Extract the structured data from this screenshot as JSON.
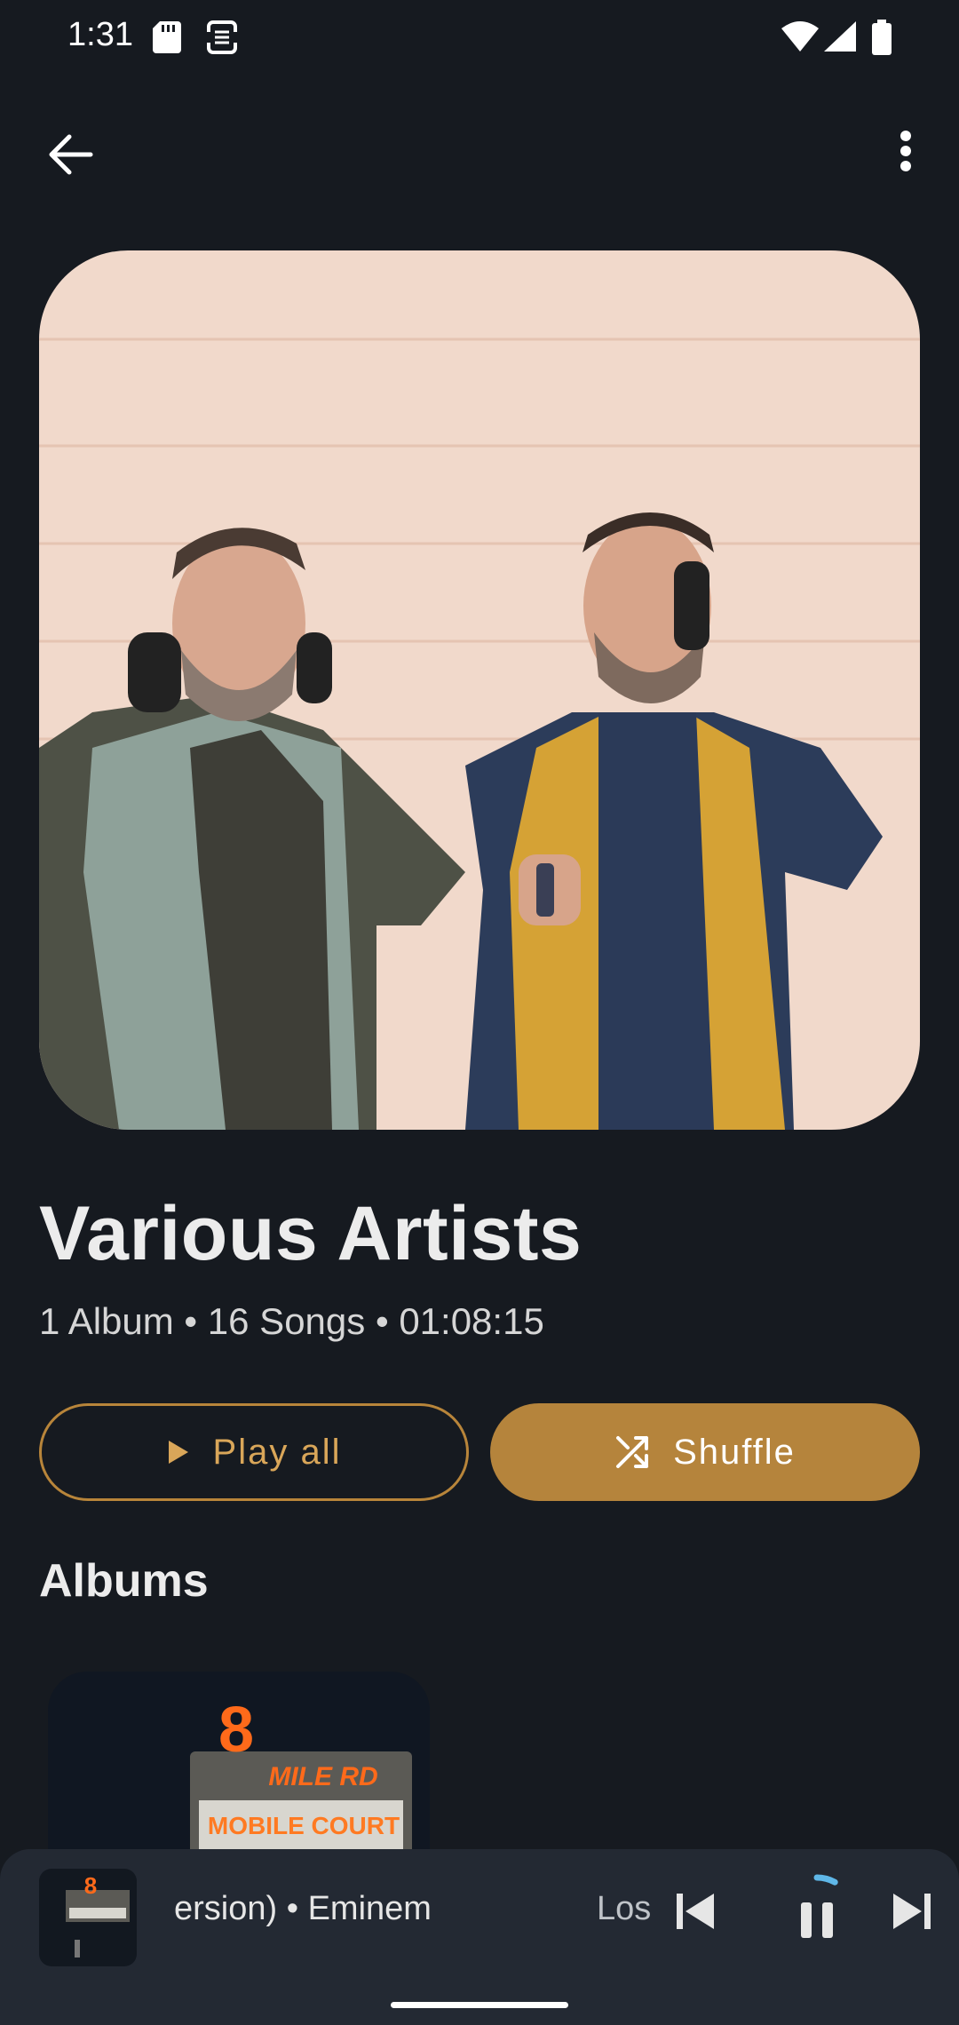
{
  "status_bar": {
    "time": "1:31",
    "icons": [
      "sd-card-icon",
      "sim-icon",
      "wifi-icon",
      "signal-icon",
      "battery-icon"
    ]
  },
  "top_bar": {
    "back_icon": "arrow-back-icon",
    "more_icon": "more-vert-icon"
  },
  "artist": {
    "name": "Various Artists",
    "meta": "1 Album • 16 Songs • 01:08:15"
  },
  "actions": {
    "play_all_label": "Play all",
    "shuffle_label": "Shuffle"
  },
  "albums": {
    "heading": "Albums",
    "items": [
      {
        "art_text_line1": "8",
        "art_text_line2": "MILE RD",
        "art_text_line3": "MOBILE COURT"
      }
    ]
  },
  "mini_player": {
    "title": "ersion) • Eminem",
    "next_preview": "Los",
    "progress_fraction": 0.08
  },
  "colors": {
    "background": "#161a20",
    "accent": "#b5843c",
    "mini_player_bg": "#232933",
    "progress_ring": "#5fb7e8"
  }
}
